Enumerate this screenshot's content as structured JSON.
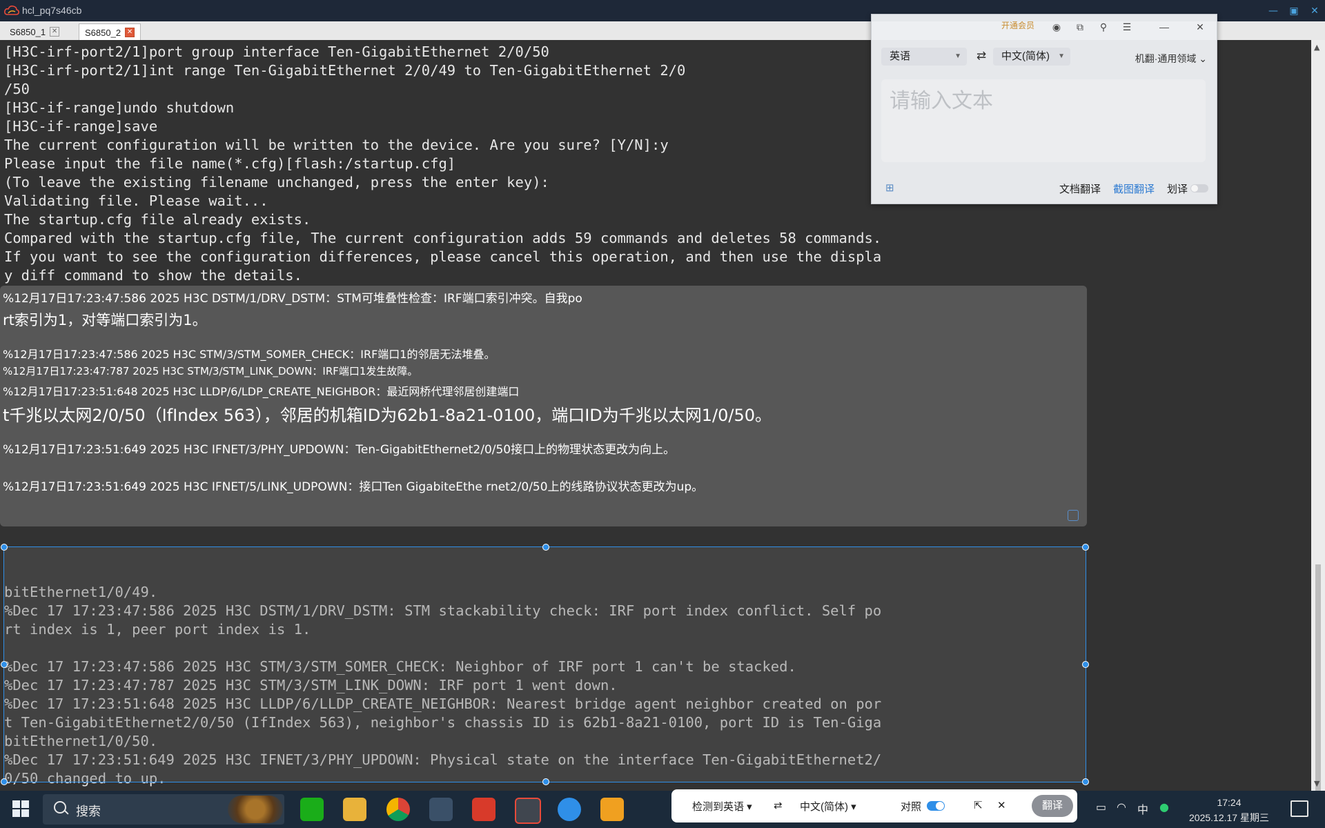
{
  "window": {
    "title": "hcl_pq7s46cb"
  },
  "tabs": [
    {
      "label": "S6850_1"
    },
    {
      "label": "S6850_2"
    }
  ],
  "terminal": {
    "lines": [
      "[H3C-irf-port2/1]port group interface Ten-GigabitEthernet 2/0/50",
      "[H3C-irf-port2/1]int range Ten-GigabitEthernet 2/0/49 to Ten-GigabitEthernet 2/0",
      "/50",
      "[H3C-if-range]undo shutdown",
      "[H3C-if-range]save",
      "The current configuration will be written to the device. Are you sure? [Y/N]:y",
      "Please input the file name(*.cfg)[flash:/startup.cfg]",
      "(To leave the existing filename unchanged, press the enter key):",
      "Validating file. Please wait...",
      "The startup.cfg file already exists.",
      "Compared with the startup.cfg file, The current configuration adds 59 commands and deletes 58 commands.",
      "If you want to see the configuration differences, please cancel this operation, and then use the displa",
      "y diff command to show the details.",
      "",
      "",
      "",
      "",
      "",
      "",
      "",
      "",
      "",
      "",
      "",
      "",
      "",
      "",
      "",
      "",
      "bitEthernet1/0/49.",
      "%Dec 17 17:23:47:586 2025 H3C DSTM/1/DRV_DSTM: STM stackability check: IRF port index conflict. Self po",
      "rt index is 1, peer port index is 1.",
      "",
      "%Dec 17 17:23:47:586 2025 H3C STM/3/STM_SOMER_CHECK: Neighbor of IRF port 1 can't be stacked.",
      "%Dec 17 17:23:47:787 2025 H3C STM/3/STM_LINK_DOWN: IRF port 1 went down.",
      "%Dec 17 17:23:51:648 2025 H3C LLDP/6/LLDP_CREATE_NEIGHBOR: Nearest bridge agent neighbor created on por",
      "t Ten-GigabitEthernet2/0/50 (IfIndex 563), neighbor's chassis ID is 62b1-8a21-0100, port ID is Ten-Giga",
      "bitEthernet1/0/50.",
      "%Dec 17 17:23:51:649 2025 H3C IFNET/3/PHY_UPDOWN: Physical state on the interface Ten-GigabitEthernet2/",
      "0/50 changed to up.",
      "%Dec 17 17:23:51:649 2025 H3C IFNET/5/LINK_UPDOWN: Line protocol state on the interface Ten-GigabitEthe",
      "rnet2/0/50 changed to up."
    ]
  },
  "overlay": {
    "lines": [
      "%12月17日17:23:47:586 2025 H3C DSTM/1/DRV_DSTM：STM可堆叠性检查：IRF端口索引冲突。自我po",
      "rt索引为1，对等端口索引为1。",
      "%12月17日17:23:47:586 2025 H3C STM/3/STM_SOMER_CHECK：IRF端口1的邻居无法堆叠。",
      "%12月17日17:23:47:787 2025 H3C STM/3/STM_LINK_DOWN：IRF端口1发生故障。",
      "%12月17日17:23:51:648 2025 H3C LLDP/6/LDP_CREATE_NEIGHBOR：最近网桥代理邻居创建端口",
      "t千兆以太网2/0/50（IfIndex 563），邻居的机箱ID为62b1-8a21-0100，端口ID为千兆以太网1/0/50。",
      "%12月17日17:23:51:649 2025 H3C IFNET/3/PHY_UPDOWN：Ten-GigabitEthernet2/0/50接口上的物理状态更改为向上。",
      "%12月17日17:23:51:649 2025 H3C IFNET/5/LINK_UDPOWN：接口Ten GigabiteEthe rnet2/0/50上的线路协议状态更改为up。"
    ]
  },
  "translator": {
    "member_label": "开通会员",
    "source_lang": "英语",
    "target_lang": "中文(简体)",
    "engine_label": "机翻·通用领域",
    "input_placeholder": "请输入文本",
    "doc_translate": "文档翻译",
    "screenshot_translate": "截图翻译",
    "word_select": "划译"
  },
  "mini_translator": {
    "detected": "检测到英语",
    "target": "中文(简体)",
    "compare": "对照",
    "translate_button": "翻译"
  },
  "taskbar": {
    "search_label": "搜索",
    "ime": "中",
    "time": "17:24",
    "date": "2025.12.17 星期三"
  },
  "colors": {
    "terminal_bg": "#323232",
    "terminal_text": "#e6e6e6",
    "selection_accent": "#2f8fe8",
    "taskbar_bg": "#1b2a3a"
  }
}
